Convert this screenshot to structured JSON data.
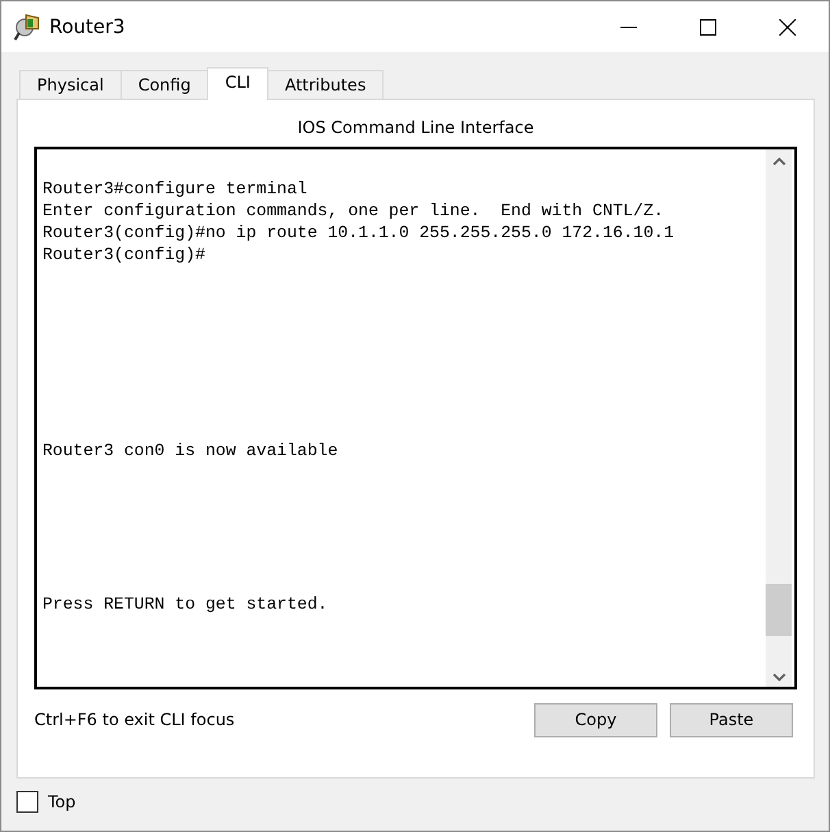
{
  "window": {
    "title": "Router3"
  },
  "tabs": [
    {
      "label": "Physical",
      "selected": false
    },
    {
      "label": "Config",
      "selected": false
    },
    {
      "label": "CLI",
      "selected": true
    },
    {
      "label": "Attributes",
      "selected": false
    }
  ],
  "panel_title": "IOS Command Line Interface",
  "terminal": {
    "blocks": [
      [
        "Router3#configure terminal",
        "Enter configuration commands, one per line.  End with CNTL/Z.",
        "Router3(config)#no ip route 10.1.1.0 255.255.255.0 172.16.10.1",
        "Router3(config)#"
      ],
      [
        "Router3 con0 is now available"
      ],
      [
        "Press RETURN to get started."
      ]
    ]
  },
  "hint": "Ctrl+F6 to exit CLI focus",
  "buttons": [
    "Copy",
    "Paste"
  ],
  "top_checkbox": {
    "label": "Top",
    "checked": false
  }
}
